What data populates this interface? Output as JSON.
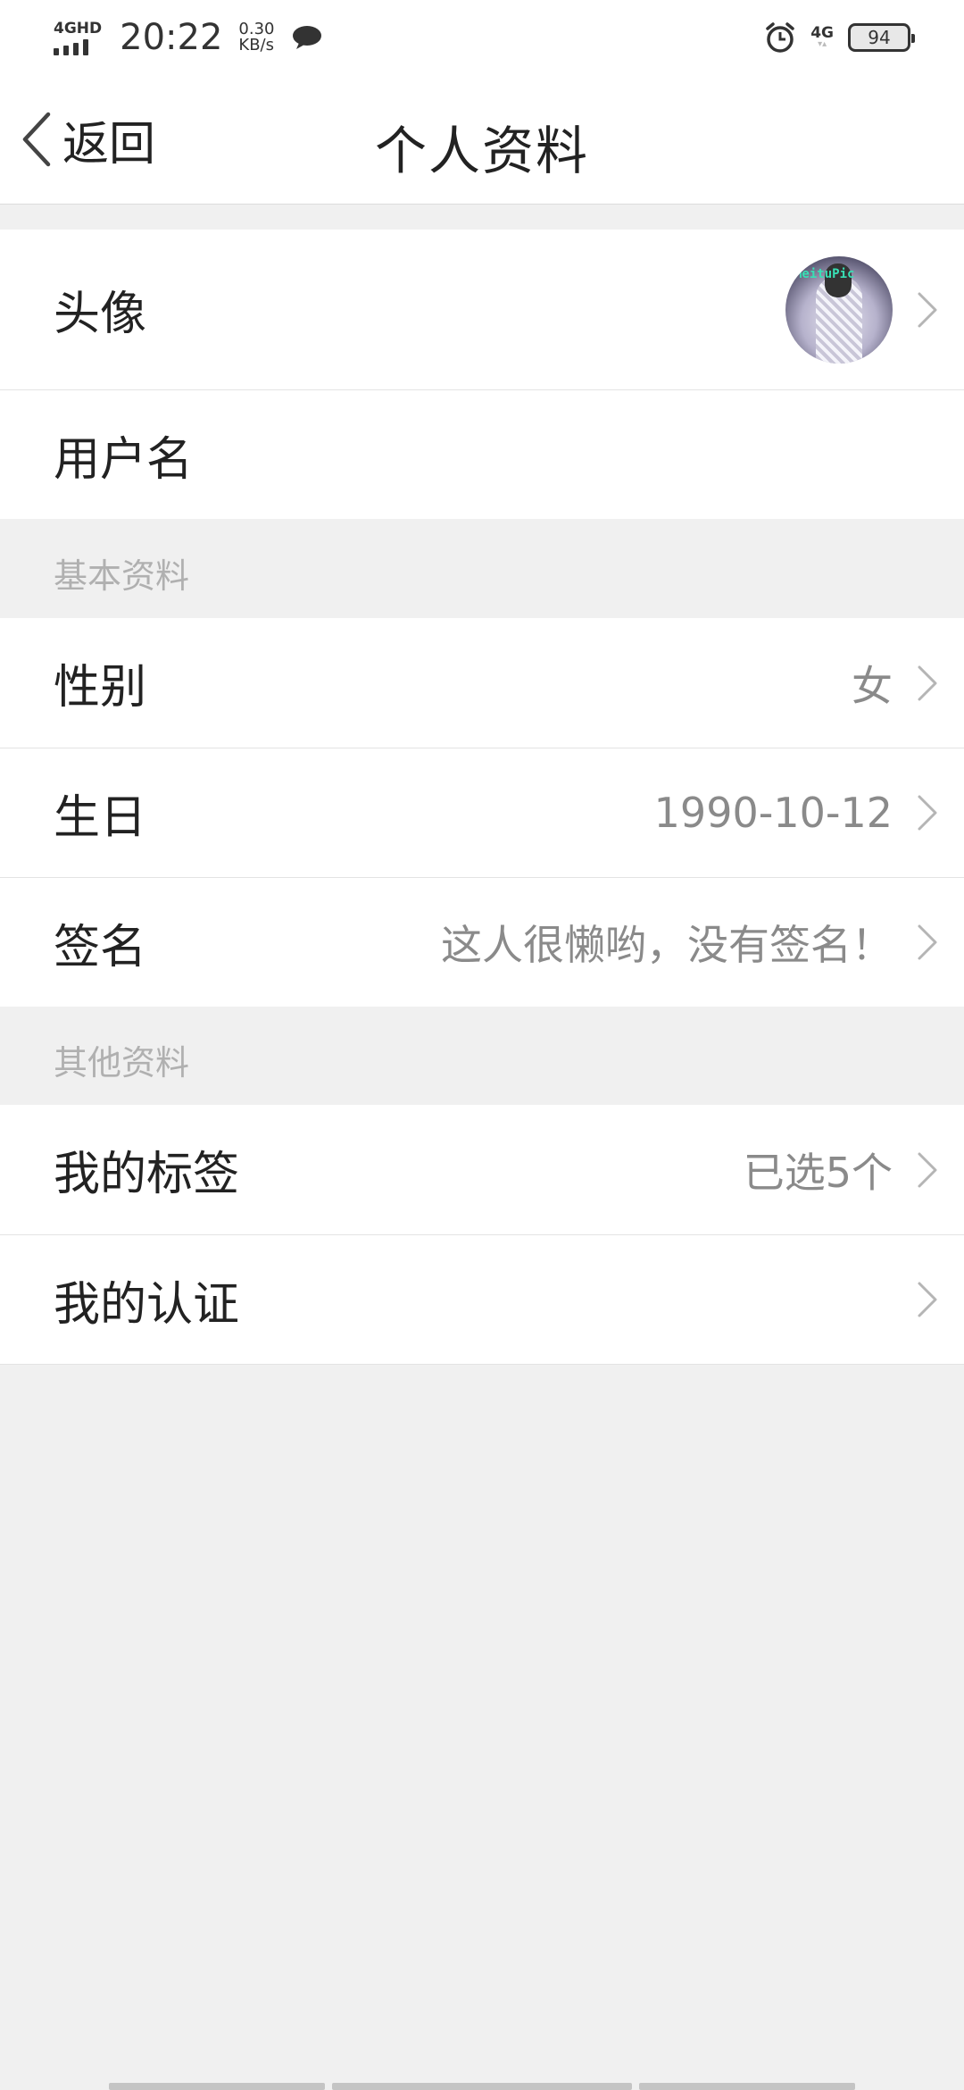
{
  "status_bar": {
    "network": "4GHD",
    "time": "20:22",
    "speed_value": "0.30",
    "speed_unit": "KB/s",
    "right_network": "4G",
    "battery": "94"
  },
  "header": {
    "back_label": "返回",
    "title": "个人资料"
  },
  "profile": {
    "avatar_label": "头像",
    "avatar_watermark": "MeituPic",
    "username_label": "用户名"
  },
  "basic_info": {
    "section_title": "基本资料",
    "gender_label": "性别",
    "gender_value": "女",
    "birthday_label": "生日",
    "birthday_value": "1990-10-12",
    "signature_label": "签名",
    "signature_value": "这人很懒哟，没有签名！"
  },
  "other_info": {
    "section_title": "其他资料",
    "tags_label": "我的标签",
    "tags_value": "已选5个",
    "verify_label": "我的认证"
  },
  "icons": {
    "back": "chevron-left-icon",
    "row_arrow": "chevron-right-icon",
    "message": "chat-bubble-icon",
    "alarm": "alarm-clock-icon"
  },
  "colors": {
    "background": "#f0f0f0",
    "card": "#ffffff",
    "primary_text": "#222222",
    "secondary_text": "#8a8a8a",
    "section_text": "#b0b0b0"
  }
}
